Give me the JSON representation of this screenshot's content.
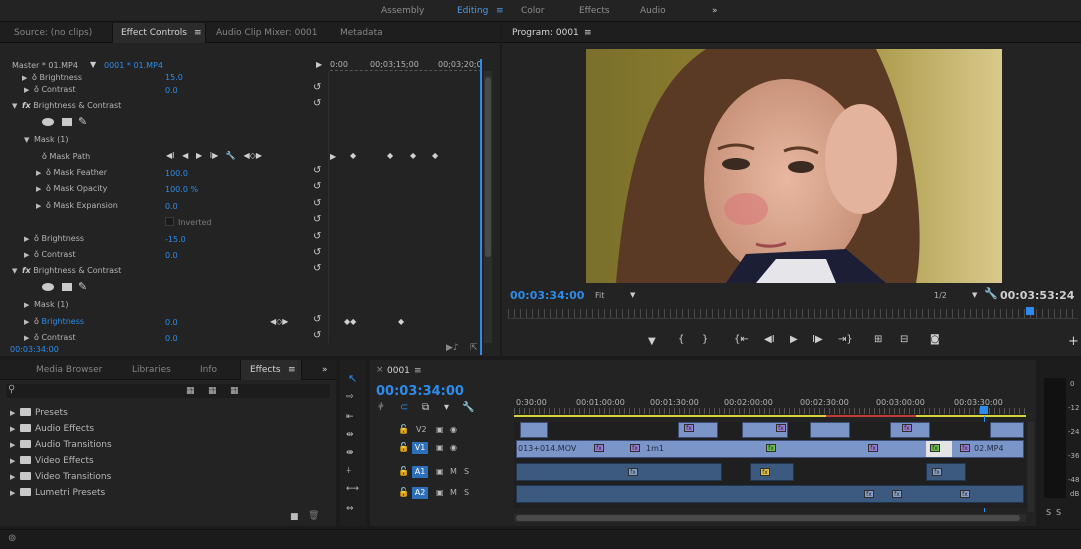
{
  "workspaces": [
    "Assembly",
    "Editing",
    "Color",
    "Effects",
    "Audio"
  ],
  "workspace_menu_icon": "hamburger-icon",
  "workspace_more": "»",
  "source_panel": {
    "tabs": [
      "Source: (no clips)",
      "Effect Controls",
      "Audio Clip Mixer: 0001",
      "Metadata"
    ],
    "tab_menu": "≡",
    "clip_selector": "Master * 01.MP4",
    "sequence_selector": "0001 * 01.MP4",
    "ruler": [
      "0:00",
      "00;03;15;00",
      "00;03;20;0"
    ],
    "rows": [
      {
        "label": "Brightness",
        "value": "15.0"
      },
      {
        "label": "Contrast",
        "value": "0.0"
      },
      {
        "label": "Brightness & Contrast",
        "value": ""
      },
      {
        "label": "Mask (1)",
        "value": ""
      },
      {
        "label": "Mask Path",
        "value": ""
      },
      {
        "label": "Mask Feather",
        "value": "100.0"
      },
      {
        "label": "Mask Opacity",
        "value": "100.0 %"
      },
      {
        "label": "Mask Expansion",
        "value": "0.0"
      },
      {
        "label": "Inverted",
        "value": ""
      },
      {
        "label": "Brightness",
        "value": "-15.0"
      },
      {
        "label": "Contrast",
        "value": "0.0"
      },
      {
        "label": "Brightness & Contrast",
        "value": ""
      },
      {
        "label": "Mask (1)",
        "value": ""
      },
      {
        "label": "Brightness",
        "value": "0.0"
      },
      {
        "label": "Contrast",
        "value": "0.0"
      }
    ],
    "fx_prefix": "fx",
    "timecode": "00:03:34:00"
  },
  "program": {
    "title": "Program: 0001",
    "menu": "≡",
    "timecode_current": "00:03:34:00",
    "fit": "Fit",
    "resolution": "1/2",
    "timecode_duration": "00:03:53:24"
  },
  "effects_panel": {
    "tabs": [
      "Media Browser",
      "Libraries",
      "Info",
      "Effects"
    ],
    "tab_menu": "≡",
    "more": "»",
    "items": [
      "Presets",
      "Audio Effects",
      "Audio Transitions",
      "Video Effects",
      "Video Transitions",
      "Lumetri Presets"
    ]
  },
  "timeline": {
    "tab": "0001",
    "close": "×",
    "menu": "≡",
    "timecode": "00:03:34:00",
    "ruler": [
      "0:30:00",
      "00:01:00:00",
      "00:01:30:00",
      "00:02:00:00",
      "00:02:30:00",
      "00:03:00:00",
      "00:03:30:00"
    ],
    "tracks": [
      {
        "name": "V2",
        "mode": "video"
      },
      {
        "name": "V1",
        "mode": "video"
      },
      {
        "name": "A1",
        "mode": "audio",
        "m": "M",
        "s": "S"
      },
      {
        "name": "A2",
        "mode": "audio",
        "m": "M",
        "s": "S"
      }
    ],
    "clip_labels": [
      "013+014.MOV",
      "1m1",
      "02.MP4"
    ],
    "fx_badge": "fx"
  },
  "meter": {
    "scale": [
      "0",
      "-12",
      "-24",
      "-36",
      "-48",
      "dB"
    ],
    "solo": [
      "S",
      "S"
    ]
  },
  "colors": {
    "accent": "#2d8ceb",
    "video_clip": "#7c95c9",
    "audio_clip": "#3c5a80",
    "panel_bg": "#232323"
  }
}
